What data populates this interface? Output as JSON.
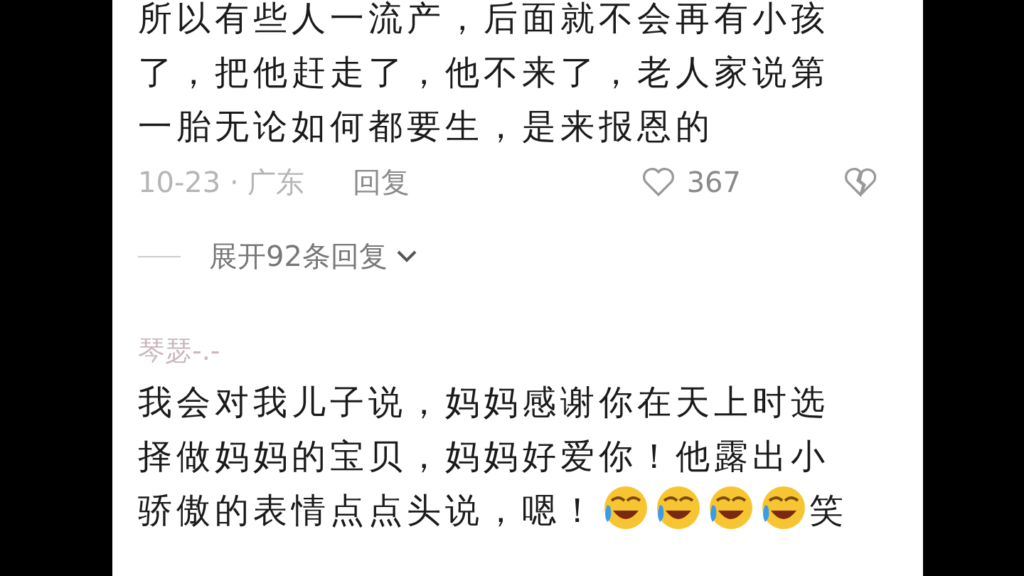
{
  "comments": [
    {
      "body": [
        {
          "kind": "text",
          "text": "所以有些人一流产，后面就不会再有小孩了，把他赶走了，他不来了，老人家说第一胎无论如何都要生，是来报恩的"
        }
      ],
      "meta": {
        "date": "10-23",
        "separator": "·",
        "region": "广东",
        "reply": "回复",
        "likes": "367",
        "liked": false
      },
      "expand": {
        "label": "展开92条回复"
      }
    },
    {
      "user": "琴瑟-.-",
      "body": [
        {
          "kind": "text",
          "text": "我会对我儿子说，妈妈感谢你在天上时选择做妈妈的宝贝，妈妈好爱你！他露出小骄傲的表情点点头说，嗯！"
        },
        {
          "kind": "emoji"
        },
        {
          "kind": "emoji"
        },
        {
          "kind": "emoji"
        },
        {
          "kind": "emoji"
        },
        {
          "kind": "text",
          "text": "笑"
        }
      ]
    }
  ]
}
